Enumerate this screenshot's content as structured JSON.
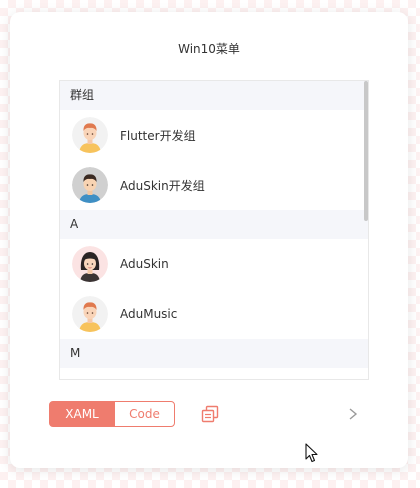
{
  "window": {
    "title": "Win10菜单"
  },
  "list": {
    "groups": [
      {
        "header": "群组",
        "items": [
          {
            "label": "Flutter开发组",
            "avatar": "boy-orange-hair-avatar"
          },
          {
            "label": "AduSkin开发组",
            "avatar": "man-grey-background-avatar"
          }
        ]
      },
      {
        "header": "A",
        "items": [
          {
            "label": "AduSkin",
            "avatar": "girl-black-hair-avatar"
          },
          {
            "label": "AduMusic",
            "avatar": "boy-orange-hair-avatar"
          }
        ]
      },
      {
        "header": "M",
        "items": []
      }
    ]
  },
  "toolbar": {
    "xaml_label": "XAML",
    "code_label": "Code",
    "selected": "XAML",
    "copy_icon": "copy-icon",
    "next_icon": "chevron-right-icon"
  },
  "colors": {
    "accent": "#ef7c6e",
    "group_header_bg": "#f5f6fa",
    "text": "#333333"
  }
}
